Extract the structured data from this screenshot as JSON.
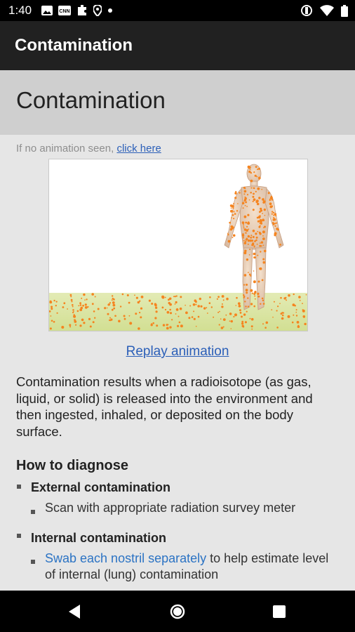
{
  "status_bar": {
    "time": "1:40",
    "left_icons": [
      "image-icon",
      "cnn-icon",
      "puzzle-icon",
      "location-icon",
      "dot-icon"
    ],
    "right_icons": [
      "vibrate-icon",
      "wifi-icon",
      "battery-icon"
    ]
  },
  "app_bar": {
    "title": "Contamination"
  },
  "page": {
    "heading": "Contamination",
    "animation_note_prefix": "If no animation seen, ",
    "animation_note_link": "click here",
    "replay_label": "Replay animation",
    "description": "Contamination results when a radioisotope (as gas, liquid, or solid) is released into the environment and then ingested, inhaled, or deposited on the body surface.",
    "how_to_diagnose": {
      "title": "How to diagnose",
      "external": {
        "label": "External contamination",
        "item": "Scan with appropriate radiation survey meter"
      },
      "internal": {
        "label": "Internal contamination",
        "item_link": "Swab each nostril separately",
        "item_rest": " to help estimate level of internal (lung) contamination"
      }
    }
  },
  "colors": {
    "app_bar": "#212121",
    "header_band": "#cfcfcf",
    "link": "#2b5fb8",
    "particle": "#f5841f",
    "ground": "#d9e6a0"
  },
  "nav_bar": {
    "icons": [
      "back-icon",
      "home-icon",
      "recents-icon"
    ]
  }
}
